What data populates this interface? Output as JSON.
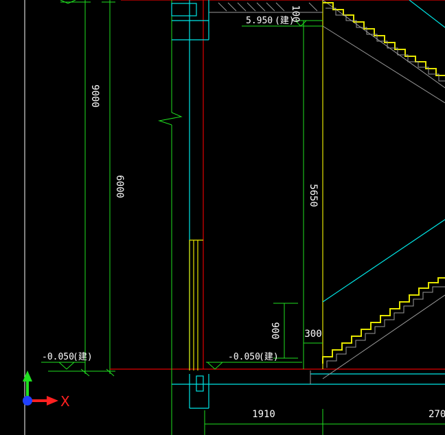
{
  "dimensions": {
    "height_total": "9000",
    "height_story": "6000",
    "stair_run": "5650",
    "rail_height": "900",
    "stair_offset": "300",
    "plan_width_1": "1910",
    "plan_width_2": "270"
  },
  "levels": {
    "level_top": "5.950",
    "level_left": "-0.050",
    "level_mid": "-0.050",
    "level_suffix": "(建)",
    "top_partial": "100"
  },
  "ucs": {
    "x_label": "X",
    "x_color": "#ff2020",
    "y_color": "#20e020",
    "origin_color": "#2040ff"
  },
  "colors": {
    "background": "#000000",
    "dimension": "#20e020",
    "cyan": "#00e5e5",
    "yellow": "#e5e500",
    "red": "#e00000",
    "gray": "#9a9a9a",
    "white": "#ffffff"
  },
  "canvas": {
    "width": 648,
    "height": 634
  }
}
